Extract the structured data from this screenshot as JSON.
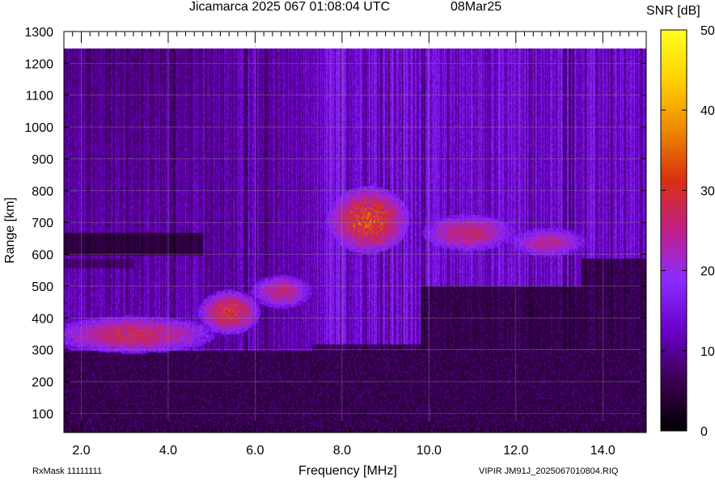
{
  "header": {
    "title": "Jicamarca 2025 067 01:08:04 UTC",
    "date": "08Mar25"
  },
  "footer": {
    "rxmask": "RxMask 11111111",
    "file": "VIPIR  JM91J_2025067010804.RIQ"
  },
  "chart_data": {
    "type": "heatmap",
    "title": "Jicamarca 2025 067 01:08:04 UTC",
    "xlabel": "Frequency [MHz]",
    "ylabel": "Range [km]",
    "xlim": [
      1.6,
      15.0
    ],
    "ylim": [
      40,
      1300
    ],
    "x_ticks": [
      {
        "value": 2,
        "label": "2.0"
      },
      {
        "value": 4,
        "label": "4.0"
      },
      {
        "value": 6,
        "label": "6.0"
      },
      {
        "value": 8,
        "label": "8.0"
      },
      {
        "value": 10,
        "label": "10.0"
      },
      {
        "value": 12,
        "label": "12.0"
      },
      {
        "value": 14,
        "label": "14.0"
      }
    ],
    "y_ticks": [
      {
        "value": 100,
        "label": "100"
      },
      {
        "value": 200,
        "label": "200"
      },
      {
        "value": 300,
        "label": "300"
      },
      {
        "value": 400,
        "label": "400"
      },
      {
        "value": 500,
        "label": "500"
      },
      {
        "value": 600,
        "label": "600"
      },
      {
        "value": 700,
        "label": "700"
      },
      {
        "value": 800,
        "label": "800"
      },
      {
        "value": 900,
        "label": "900"
      },
      {
        "value": 1000,
        "label": "1000"
      },
      {
        "value": 1100,
        "label": "1100"
      },
      {
        "value": 1200,
        "label": "1200"
      },
      {
        "value": 1300,
        "label": "1300"
      }
    ],
    "grid": true,
    "data_range": {
      "x": [
        1.6,
        15.0
      ],
      "y": [
        40,
        1245
      ]
    },
    "colorbar": {
      "label": "SNR [dB]",
      "range": [
        0,
        50
      ],
      "ticks": [
        0,
        10,
        20,
        30,
        40,
        50
      ],
      "colormap": [
        "#000000",
        "#3a0050",
        "#6a00c8",
        "#8a2cff",
        "#c0208a",
        "#d83010",
        "#ee8800",
        "#ffd000",
        "#ffff20"
      ]
    },
    "regions": [
      {
        "feature": "E/F-layer trace (low frequency)",
        "freq_mhz": [
          1.6,
          4.8
        ],
        "range_km": [
          300,
          400
        ],
        "snr_db": 28
      },
      {
        "feature": "F-layer trace",
        "freq_mhz": [
          4.8,
          6.0
        ],
        "range_km": [
          360,
          480
        ],
        "snr_db": 30
      },
      {
        "feature": "F-layer trace",
        "freq_mhz": [
          6.0,
          7.2
        ],
        "range_km": [
          440,
          530
        ],
        "snr_db": 26
      },
      {
        "feature": "Spread F echo",
        "freq_mhz": [
          7.8,
          9.4
        ],
        "range_km": [
          620,
          800
        ],
        "snr_db": 32
      },
      {
        "feature": "Spread F echo",
        "freq_mhz": [
          10.0,
          11.8
        ],
        "range_km": [
          620,
          720
        ],
        "snr_db": 27
      },
      {
        "feature": "Spread F echo",
        "freq_mhz": [
          12.0,
          13.5
        ],
        "range_km": [
          600,
          680
        ],
        "snr_db": 25
      },
      {
        "feature": "Background noise below trace",
        "freq_mhz": [
          1.6,
          15.0
        ],
        "range_km": [
          40,
          300
        ],
        "snr_db": 3
      }
    ]
  }
}
